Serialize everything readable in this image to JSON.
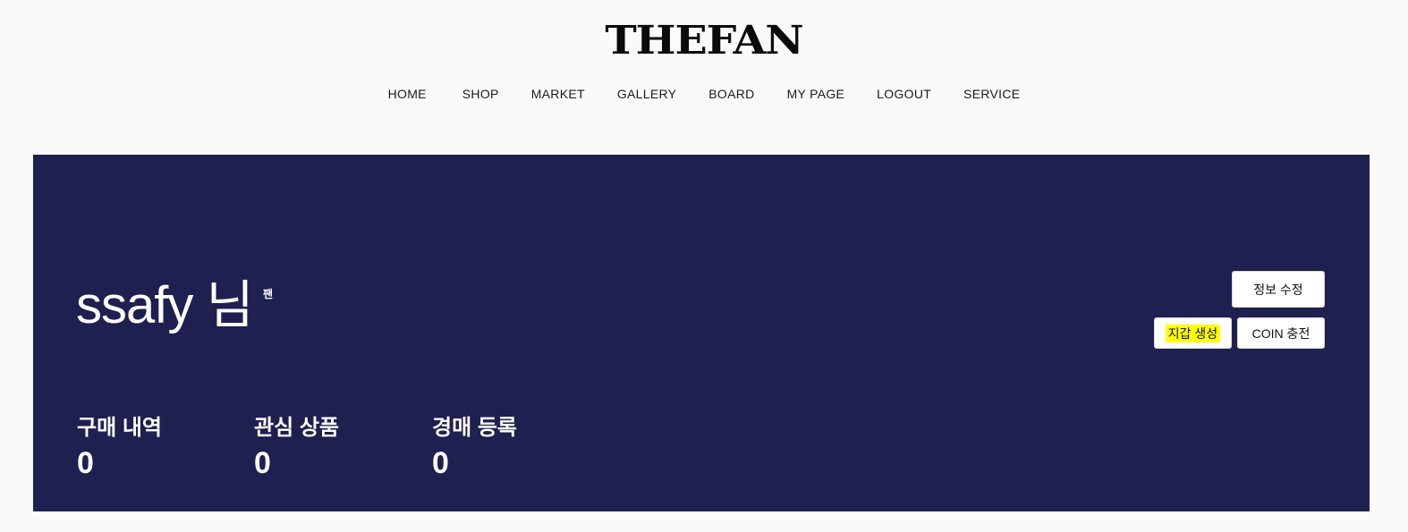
{
  "header": {
    "logo_text": "THEFAN",
    "nav": [
      "HOME",
      "SHOP",
      "MARKET",
      "GALLERY",
      "BOARD",
      "MY PAGE",
      "LOGOUT",
      "SERVICE"
    ]
  },
  "profile": {
    "username": "ssafy 님",
    "grade": "팬",
    "buttons": {
      "edit": "정보 수정",
      "wallet": "지갑 생성",
      "coin": "COIN 충전"
    },
    "stats": [
      {
        "label": "구매 내역",
        "value": "0"
      },
      {
        "label": "관심 상품",
        "value": "0"
      },
      {
        "label": "경매 등록",
        "value": "0"
      }
    ]
  },
  "colors": {
    "hero_background": "#1f2050",
    "highlight": "#ffff00"
  }
}
